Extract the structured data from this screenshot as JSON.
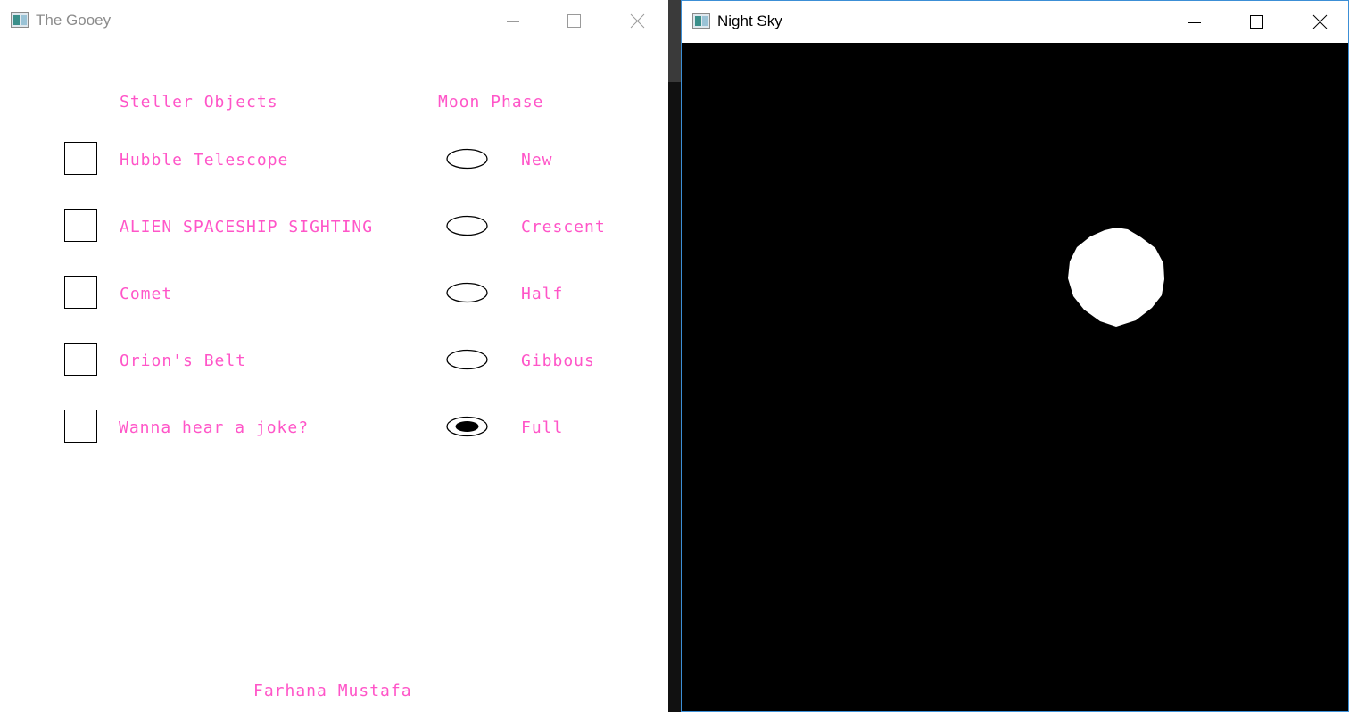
{
  "gooey_window": {
    "title": "The Gooey",
    "stellar_header": "Steller Objects",
    "moon_header": "Moon Phase",
    "checkboxes": [
      {
        "label": "Hubble Telescope",
        "checked": false
      },
      {
        "label": "ALIEN SPACESHIP SIGHTING",
        "checked": false
      },
      {
        "label": "Comet",
        "checked": false
      },
      {
        "label": "Orion's Belt",
        "checked": false
      },
      {
        "label": "Wanna hear a joke?",
        "checked": false
      }
    ],
    "radios": [
      {
        "label": "New",
        "selected": false
      },
      {
        "label": "Crescent",
        "selected": false
      },
      {
        "label": "Half",
        "selected": false
      },
      {
        "label": "Gibbous",
        "selected": false
      },
      {
        "label": "Full",
        "selected": true
      }
    ],
    "footer": "Farhana Mustafa",
    "text_color": "#ff55c8"
  },
  "sky_window": {
    "title": "Night Sky",
    "background": "#000000",
    "moon_phase_shown": "Full",
    "moon_color": "#ffffff"
  },
  "icons": {
    "app": "app-window-icon",
    "minimize": "minimize-icon",
    "maximize": "maximize-icon",
    "close": "close-icon"
  }
}
